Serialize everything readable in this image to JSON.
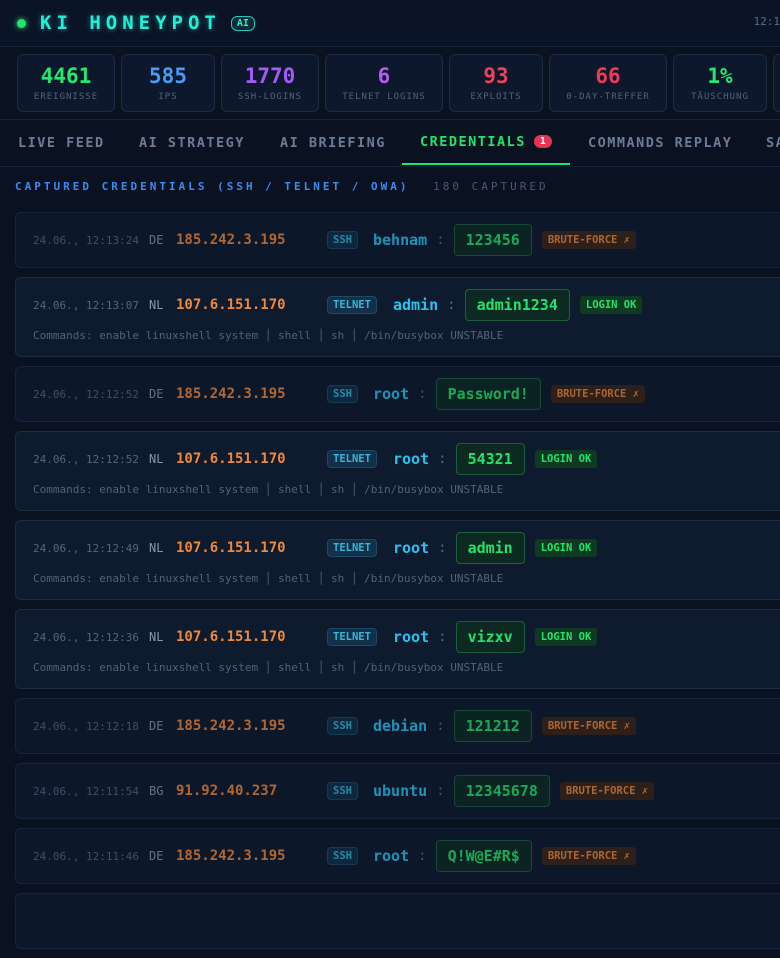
{
  "header": {
    "brand": "KI HONEYPOT",
    "badge": "AI",
    "clock": "12:1"
  },
  "stats": [
    {
      "value": "4461",
      "label": "EREIGNISSE",
      "color": "#23e86f"
    },
    {
      "value": "585",
      "label": "IPS",
      "color": "#4a9cf5"
    },
    {
      "value": "1770",
      "label": "SSH-LOGINS",
      "color": "#a25cf5"
    },
    {
      "value": "6",
      "label": "TELNET LOGINS",
      "color": "#b65cf0"
    },
    {
      "value": "93",
      "label": "EXPLOITS",
      "color": "#f0405a"
    },
    {
      "value": "66",
      "label": "0-DAY-TREFFER",
      "color": "#ee3a55"
    },
    {
      "value": "1%",
      "label": "TÄUSCHUNG",
      "color": "#23e86f"
    }
  ],
  "tabs": [
    "LIVE FEED",
    "AI STRATEGY",
    "AI BRIEFING",
    "CREDENTIALS",
    "COMMANDS REPLAY",
    "SA"
  ],
  "tab_badge": "1",
  "section": {
    "title": "CAPTURED CREDENTIALS (SSH / TELNET / OWA)",
    "count": "180 CAPTURED"
  },
  "status_labels": {
    "brute": "BRUTE-FORCE ✗",
    "ok": "LOGIN OK"
  },
  "entries": [
    {
      "ts": "24.06., 12:13:24",
      "cc": "DE",
      "ip": "185.242.3.195",
      "proto": "SSH",
      "user": "behnam",
      "pass": "123456",
      "status": "brute",
      "commands": ""
    },
    {
      "ts": "24.06., 12:13:07",
      "cc": "NL",
      "ip": "107.6.151.170",
      "proto": "TELNET",
      "user": "admin",
      "pass": "admin1234",
      "status": "ok",
      "commands": "Commands: enable linuxshell system │ shell │ sh │ /bin/busybox UNSTABLE"
    },
    {
      "ts": "24.06., 12:12:52",
      "cc": "DE",
      "ip": "185.242.3.195",
      "proto": "SSH",
      "user": "root",
      "pass": "Password!",
      "status": "brute",
      "commands": ""
    },
    {
      "ts": "24.06., 12:12:52",
      "cc": "NL",
      "ip": "107.6.151.170",
      "proto": "TELNET",
      "user": "root",
      "pass": "54321",
      "status": "ok",
      "commands": "Commands: enable linuxshell system │ shell │ sh │ /bin/busybox UNSTABLE"
    },
    {
      "ts": "24.06., 12:12:49",
      "cc": "NL",
      "ip": "107.6.151.170",
      "proto": "TELNET",
      "user": "root",
      "pass": "admin",
      "status": "ok",
      "commands": "Commands: enable linuxshell system │ shell │ sh │ /bin/busybox UNSTABLE"
    },
    {
      "ts": "24.06., 12:12:36",
      "cc": "NL",
      "ip": "107.6.151.170",
      "proto": "TELNET",
      "user": "root",
      "pass": "vizxv",
      "status": "ok",
      "commands": "Commands: enable linuxshell system │ shell │ sh │ /bin/busybox UNSTABLE"
    },
    {
      "ts": "24.06., 12:12:18",
      "cc": "DE",
      "ip": "185.242.3.195",
      "proto": "SSH",
      "user": "debian",
      "pass": "121212",
      "status": "brute",
      "commands": ""
    },
    {
      "ts": "24.06., 12:11:54",
      "cc": "BG",
      "ip": "91.92.40.237",
      "proto": "SSH",
      "user": "ubuntu",
      "pass": "12345678",
      "status": "brute",
      "commands": ""
    },
    {
      "ts": "24.06., 12:11:46",
      "cc": "DE",
      "ip": "185.242.3.195",
      "proto": "SSH",
      "user": "root",
      "pass": "Q!W@E#R$",
      "status": "brute",
      "commands": ""
    }
  ]
}
